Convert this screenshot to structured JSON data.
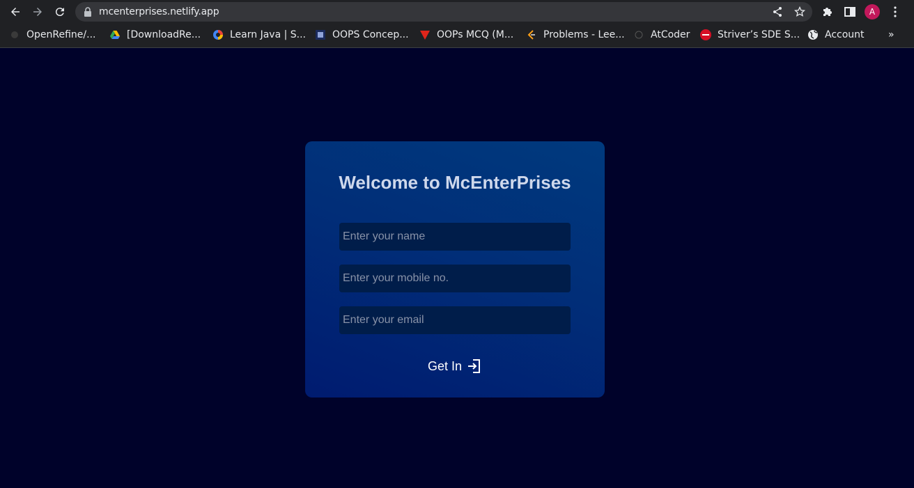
{
  "browser": {
    "url": "mcenterprises.netlify.app",
    "profile_initial": "A",
    "bookmarks": [
      {
        "label": "OpenRefine/..."
      },
      {
        "label": "[DownloadRe..."
      },
      {
        "label": "Learn Java | S..."
      },
      {
        "label": "OOPS Concep..."
      },
      {
        "label": "OOPs MCQ (M..."
      },
      {
        "label": "Problems - Lee..."
      },
      {
        "label": "AtCoder"
      },
      {
        "label": "Striver’s SDE S..."
      },
      {
        "label": "Account"
      }
    ],
    "more_bookmarks": "»"
  },
  "page": {
    "title": "Welcome to McEnterPrises",
    "name_placeholder": "Enter your name",
    "mobile_placeholder": "Enter your mobile no.",
    "email_placeholder": "Enter your email",
    "submit_label": "Get In"
  },
  "colors": {
    "background": "#00022a",
    "card": "#012e78",
    "field": "#001d4a",
    "title_text": "#cfd8ec",
    "avatar": "#c2185b"
  }
}
